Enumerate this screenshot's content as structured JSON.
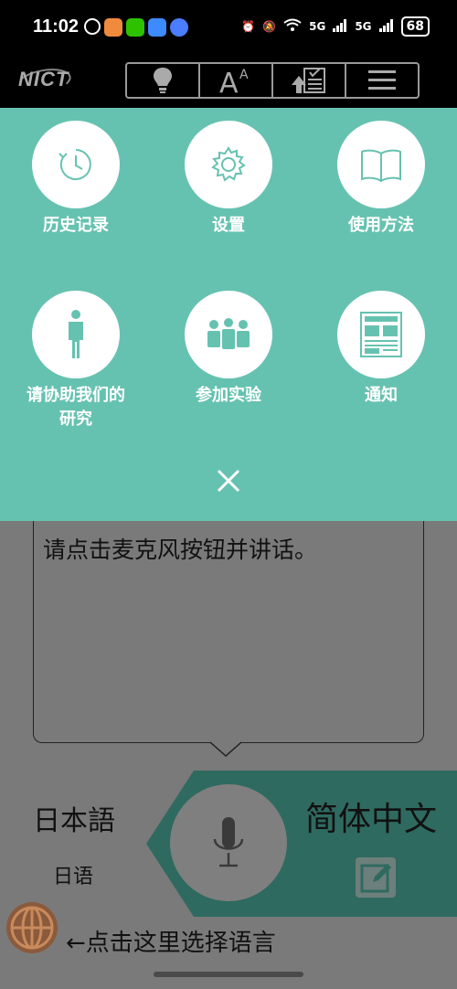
{
  "status_bar": {
    "time": "11:02",
    "network_a": "5G",
    "network_b": "5G",
    "battery": "68"
  },
  "app_bar": {
    "logo": "NICT",
    "toolbar": [
      "lightbulb-icon",
      "font-size-icon",
      "upload-list-icon",
      "hamburger-menu-icon"
    ]
  },
  "menu": {
    "items": [
      {
        "label": "历史记录",
        "icon": "history-icon"
      },
      {
        "label": "设置",
        "icon": "gear-icon"
      },
      {
        "label": "使用方法",
        "icon": "book-icon"
      },
      {
        "label": "请协助我们的\n研究",
        "icon": "person-icon"
      },
      {
        "label": "参加实验",
        "icon": "group-icon"
      },
      {
        "label": "通知",
        "icon": "newspaper-icon"
      }
    ],
    "close_icon": "close-icon"
  },
  "speech": {
    "prompt": "请点击麦克风按钮并讲话。"
  },
  "languages": {
    "source": "日本語",
    "source_sub": "日语",
    "target": "简体中文"
  },
  "hint": {
    "text": "←点击这里选择语言"
  },
  "colors": {
    "menu_bg": "#66c2b0",
    "dim_bg": "#7a7a7a",
    "target_bg": "#2f6a60",
    "icon_teal": "#66c2b0"
  }
}
